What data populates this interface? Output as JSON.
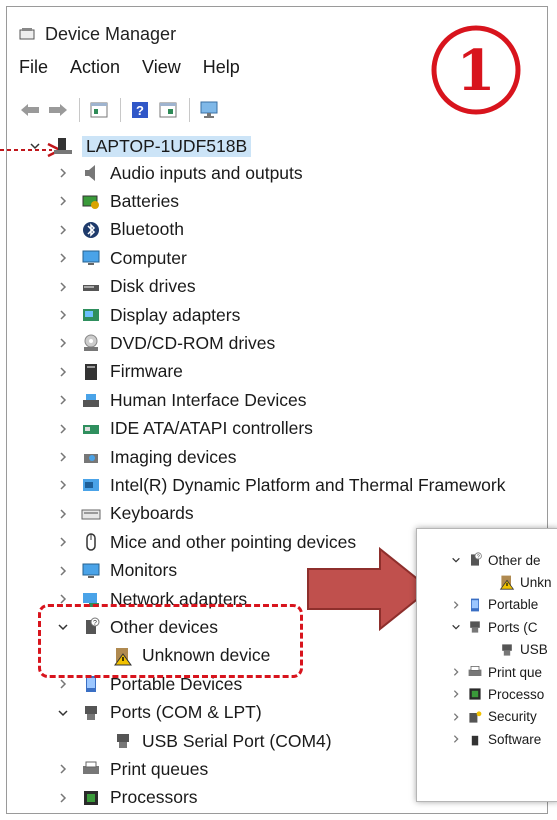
{
  "window": {
    "title": "Device Manager"
  },
  "menu": [
    "File",
    "Action",
    "View",
    "Help"
  ],
  "badge": "①",
  "tree": {
    "root": "LAPTOP-1UDF518B",
    "items": [
      {
        "label": "Audio inputs and outputs",
        "icon": "speaker-icon"
      },
      {
        "label": "Batteries",
        "icon": "battery-icon"
      },
      {
        "label": "Bluetooth",
        "icon": "bluetooth-icon"
      },
      {
        "label": "Computer",
        "icon": "monitor-icon"
      },
      {
        "label": "Disk drives",
        "icon": "disk-drive-icon"
      },
      {
        "label": "Display adapters",
        "icon": "display-adapter-icon"
      },
      {
        "label": "DVD/CD-ROM drives",
        "icon": "dvd-icon"
      },
      {
        "label": "Firmware",
        "icon": "firmware-icon"
      },
      {
        "label": "Human Interface Devices",
        "icon": "hid-icon"
      },
      {
        "label": "IDE ATA/ATAPI controllers",
        "icon": "ide-controller-icon"
      },
      {
        "label": "Imaging devices",
        "icon": "camera-icon"
      },
      {
        "label": "Intel(R) Dynamic Platform and Thermal Framework",
        "icon": "chip-icon"
      },
      {
        "label": "Keyboards",
        "icon": "keyboard-icon"
      },
      {
        "label": "Mice and other pointing devices",
        "icon": "mouse-icon"
      },
      {
        "label": "Monitors",
        "icon": "monitor-icon"
      },
      {
        "label": "Network adapters",
        "icon": "network-icon"
      },
      {
        "label": "Other devices",
        "icon": "unknown-device-icon",
        "expanded": true
      },
      {
        "label": "Unknown device",
        "icon": "warning-device-icon",
        "child": true
      },
      {
        "label": "Portable Devices",
        "icon": "portable-device-icon"
      },
      {
        "label": "Ports (COM & LPT)",
        "icon": "port-icon",
        "expanded": true
      },
      {
        "label": "USB Serial Port (COM4)",
        "icon": "port-icon",
        "child": true
      },
      {
        "label": "Print queues",
        "icon": "printer-icon"
      },
      {
        "label": "Processors",
        "icon": "processor-icon"
      }
    ]
  },
  "popout": {
    "items": [
      {
        "label": "Other de",
        "expanded": true
      },
      {
        "label": "Unkn",
        "child": true
      },
      {
        "label": "Portable"
      },
      {
        "label": "Ports (C",
        "expanded": true
      },
      {
        "label": "USB",
        "child": true
      },
      {
        "label": "Print que"
      },
      {
        "label": "Processo"
      },
      {
        "label": "Security"
      },
      {
        "label": "Software"
      }
    ]
  },
  "colors": {
    "annotation": "#d8141d",
    "arrow": "#c0504d",
    "selection": "#cce4f7"
  }
}
